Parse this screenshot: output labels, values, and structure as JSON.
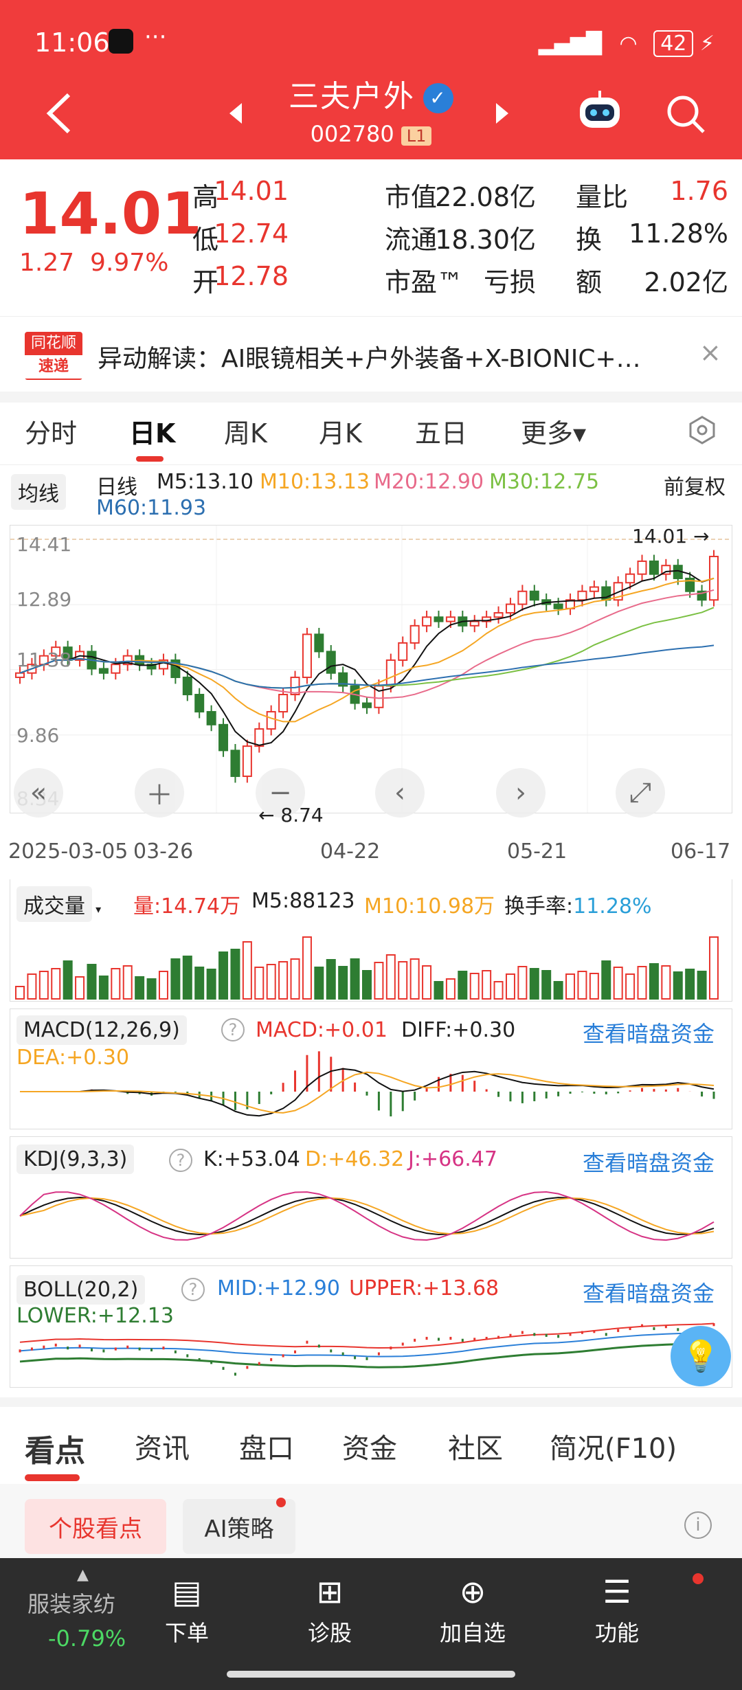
{
  "status": {
    "time": "11:06",
    "battery": "42"
  },
  "header": {
    "title": "三夫户外",
    "code": "002780",
    "level": "L1"
  },
  "quote": {
    "price": "14.01",
    "change": "1.27",
    "change_pct": "9.97%",
    "rows": [
      [
        {
          "k": "高",
          "v": "14.01"
        },
        {
          "k": "市值",
          "v": "22.08亿"
        },
        {
          "k": "量比",
          "v": "1.76"
        }
      ],
      [
        {
          "k": "低",
          "v": "12.74"
        },
        {
          "k": "流通",
          "v": "18.30亿"
        },
        {
          "k": "换",
          "v": "11.28%"
        }
      ],
      [
        {
          "k": "开",
          "v": "12.78"
        },
        {
          "k": "市盈™",
          "v": "亏损"
        },
        {
          "k": "额",
          "v": "2.02亿"
        }
      ]
    ]
  },
  "news": {
    "logo_top": "同花顺",
    "logo_bottom": "速递",
    "text": "异动解读：AI眼镜相关+户外装备+X-BIONIC+…",
    "close": "×"
  },
  "ktabs": [
    "分时",
    "日K",
    "周K",
    "月K",
    "五日",
    "更多▾"
  ],
  "indicator": {
    "ma_select": "均线",
    "line": "日线",
    "m5": "M5:13.10",
    "m10": "M10:13.13",
    "m20": "M20:12.90",
    "m30": "M30:12.75",
    "m60": "M60:11.93",
    "adj": "前复权"
  },
  "colors": {
    "red": "#e8352e",
    "green": "#2e7d32",
    "orange": "#f5a623",
    "pink": "#e86a8a",
    "blue": "#2a7fd8",
    "m30": "#7bc043",
    "m60": "#2c6fb0"
  },
  "main_chart": {
    "y_ticks": [
      "14.41",
      "12.89",
      "11.38",
      "9.86",
      "8.34"
    ],
    "x_ticks": [
      "2025-03-05",
      "03-26",
      "04-22",
      "05-21",
      "06-17"
    ],
    "high_label": "14.01",
    "low_label": "8.74",
    "closes": [
      11.3,
      11.5,
      11.7,
      11.9,
      11.6,
      11.8,
      11.4,
      11.3,
      11.5,
      11.7,
      11.5,
      11.4,
      11.6,
      11.2,
      10.8,
      10.4,
      10.1,
      9.5,
      8.9,
      9.6,
      10.0,
      10.4,
      10.8,
      11.2,
      12.2,
      11.8,
      11.3,
      11.0,
      10.6,
      10.5,
      11.0,
      11.6,
      12.0,
      12.4,
      12.6,
      12.5,
      12.6,
      12.4,
      12.5,
      12.6,
      12.7,
      12.9,
      13.2,
      13.0,
      12.9,
      12.8,
      13.0,
      13.2,
      13.3,
      13.0,
      13.4,
      13.6,
      13.9,
      13.6,
      13.8,
      13.5,
      13.2,
      13.0,
      14.01
    ]
  },
  "volume": {
    "select": "成交量",
    "vol": "量:14.74万",
    "m5": "M5:88123",
    "m10": "M10:10.98万",
    "turnover_label": "换手率:",
    "turnover": "11.28%"
  },
  "macd": {
    "select": "MACD(12,26,9)",
    "macd": "MACD:+0.01",
    "diff": "DIFF:+0.30",
    "dea": "DEA:+0.30",
    "link": "查看暗盘资金"
  },
  "kdj": {
    "select": "KDJ(9,3,3)",
    "k": "K:+53.04",
    "d": "D:+46.32",
    "j": "J:+66.47",
    "link": "查看暗盘资金"
  },
  "boll": {
    "select": "BOLL(20,2)",
    "mid": "MID:+12.90",
    "upper": "UPPER:+13.68",
    "lower": "LOWER:+12.13",
    "link": "查看暗盘资金"
  },
  "btabs": [
    "看点",
    "资讯",
    "盘口",
    "资金",
    "社区",
    "简况(F10)"
  ],
  "subtabs": {
    "a": "个股看点",
    "b": "AI策略"
  },
  "bottom": {
    "sector": "服装家纺",
    "sector_chg": "-0.79%",
    "items": [
      "下单",
      "诊股",
      "加自选",
      "功能"
    ]
  }
}
